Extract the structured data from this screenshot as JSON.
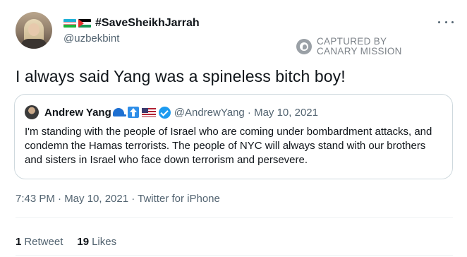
{
  "tweet": {
    "display_name": "#SaveSheikhJarrah",
    "handle": "@uzbekbint",
    "text": "I always said Yang was a spineless bitch boy!",
    "flags": [
      "uzbekistan-flag",
      "palestine-flag"
    ],
    "watermark": {
      "line1": "CAPTURED BY",
      "line2": "CANARY MISSION"
    },
    "timestamp": "7:43 PM · May 10, 2021 · Twitter for iPhone",
    "retweets_count": "1",
    "retweets_label": "Retweet",
    "likes_count": "19",
    "likes_label": "Likes"
  },
  "quote": {
    "name": "Andrew Yang",
    "handle_date": "@AndrewYang · May 10, 2021",
    "text": "I'm standing with the people of Israel who are coming under bombardment attacks, and condemn the Hamas terrorists. The people of NYC will always stand with our brothers and sisters in Israel who face down terrorism and persevere.",
    "emojis": [
      "blue-cap-icon",
      "up-arrow-icon",
      "us-flag-icon"
    ],
    "verified": true
  },
  "colors": {
    "text_primary": "#0f1419",
    "text_secondary": "#536471",
    "border": "#cfd9de",
    "verified_blue": "#1d9bf0"
  }
}
